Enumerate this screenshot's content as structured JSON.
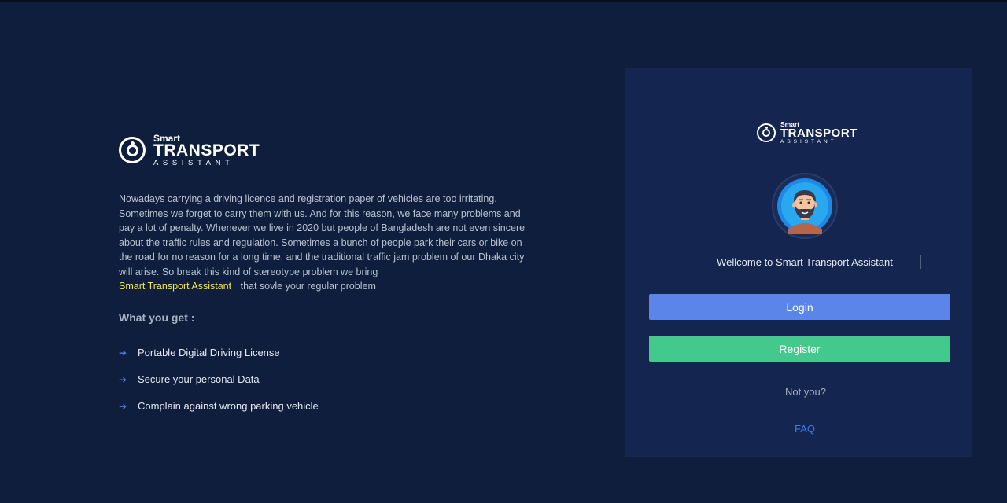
{
  "brand": {
    "smart": "Smart",
    "transport": "TRANSPORT",
    "assistant": "ASSISTANT",
    "logo_icon": "smart-transport-logo-icon"
  },
  "intro": {
    "text": "Nowadays carrying a driving licence and registration paper of vehicles are too irritating. Sometimes we forget to carry them with us. And for this reason, we face many problems and pay a lot of penalty. Whenever we live in 2020 but people of Bangladesh are not even sincere about the traffic rules and regulation. Sometimes a bunch of people park their cars or bike on the road for no reason for a long time, and the traditional traffic jam problem of our Dhaka city will arise. So break this kind of stereotype problem we bring",
    "highlight": "Smart Transport Assistant",
    "tail": "that sovle your regular problem",
    "highlight_color": "#f5e63a"
  },
  "features": {
    "heading": "What you get :",
    "items": [
      {
        "label": "Portable Digital Driving License"
      },
      {
        "label": "Secure your personal Data"
      },
      {
        "label": "Complain against wrong parking vehicle"
      }
    ]
  },
  "card": {
    "welcome": "Wellcome to Smart Transport Assistant",
    "login_label": "Login",
    "register_label": "Register",
    "not_you": "Not you?",
    "faq": "FAQ",
    "colors": {
      "login": "#5b85e8",
      "register": "#44c98c",
      "faq": "#3b7ae8",
      "background": "#142650"
    }
  }
}
